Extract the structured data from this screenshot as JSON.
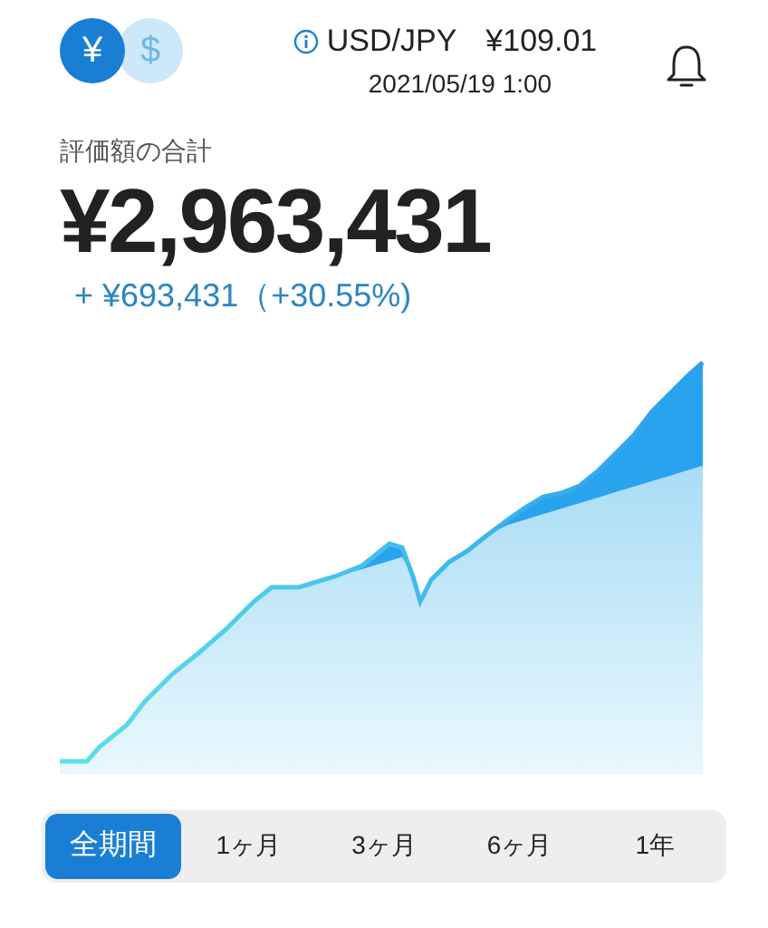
{
  "currency_toggle": [
    {
      "symbol": "¥",
      "selected": true
    },
    {
      "symbol": "$",
      "selected": false
    }
  ],
  "rate": {
    "pair": "USD/JPY",
    "value": "¥109.01",
    "timestamp": "2021/05/19 1:00"
  },
  "summary": {
    "label": "評価額の合計",
    "total": "¥2,963,431",
    "change": "+ ¥693,431（+30.55%)"
  },
  "periods": [
    {
      "label": "全期間",
      "selected": true
    },
    {
      "label": "1ヶ月",
      "selected": false
    },
    {
      "label": "3ヶ月",
      "selected": false
    },
    {
      "label": "6ヶ月",
      "selected": false
    },
    {
      "label": "1年",
      "selected": false
    }
  ]
}
